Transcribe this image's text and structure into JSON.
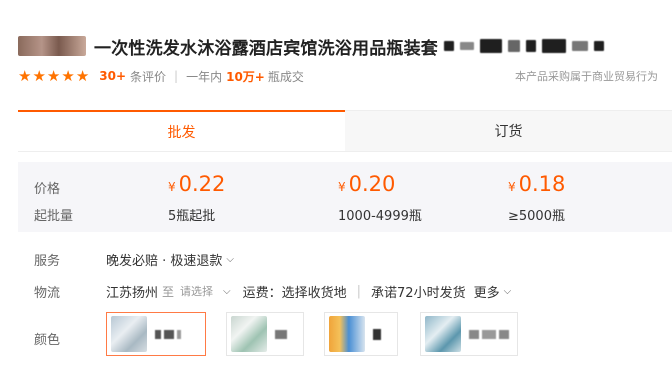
{
  "product": {
    "title": "一次性洗发水沐浴露酒店宾馆洗浴用品瓶装套"
  },
  "rating": {
    "stars": 5,
    "review_count": "30+",
    "review_label": "条评价",
    "sold_period": "一年内",
    "sold_count": "10万+",
    "sold_label": "瓶成交",
    "business_note": "本产品采购属于商业贸易行为"
  },
  "tabs": [
    {
      "label": "批发",
      "active": true
    },
    {
      "label": "订货",
      "active": false
    }
  ],
  "pricing": {
    "price_label": "价格",
    "moq_label": "起批量",
    "currency": "¥",
    "tiers": [
      {
        "price": "0.22",
        "qty": "5瓶起批"
      },
      {
        "price": "0.20",
        "qty": "1000-4999瓶"
      },
      {
        "price": "0.18",
        "qty": "≥5000瓶"
      }
    ]
  },
  "service": {
    "label": "服务",
    "value": "晚发必赔 · 极速退款"
  },
  "logistics": {
    "label": "物流",
    "origin": "江苏扬州",
    "to": "至",
    "dest_placeholder": "请选择",
    "shipping": "运费：选择收货地",
    "promise": "承诺72小时发货",
    "more": "更多"
  },
  "color": {
    "label": "颜色",
    "colors": {
      "accent": "#ff5a00",
      "selected_border": "#ff7a45"
    }
  }
}
